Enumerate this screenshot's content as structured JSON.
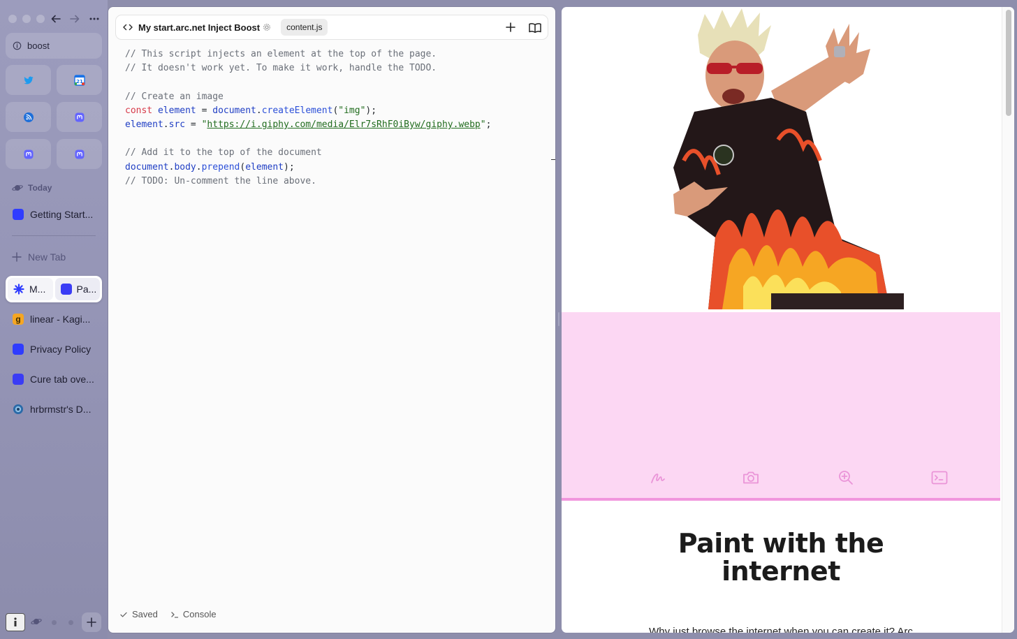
{
  "window": {
    "controls": [
      "close",
      "minimize",
      "zoom"
    ]
  },
  "sidebar": {
    "address": "boost",
    "favorites": [
      {
        "name": "twitter",
        "icon": "twitter-bird-icon",
        "color": "#1d9bf0"
      },
      {
        "name": "calendar",
        "icon": "google-calendar-icon",
        "color": "#1a73e8",
        "badge": "21"
      },
      {
        "name": "feed",
        "icon": "feed-icon",
        "color": "#1e6fd9"
      },
      {
        "name": "mastodon-1",
        "icon": "mastodon-icon",
        "color": "#6364ff"
      },
      {
        "name": "mastodon-2",
        "icon": "mastodon-icon",
        "color": "#6364ff"
      },
      {
        "name": "mastodon-3",
        "icon": "mastodon-icon",
        "color": "#6364ff"
      }
    ],
    "section_label": "Today",
    "today_tabs": [
      {
        "label": "Getting Start...",
        "icon_color": "#2f3cff"
      }
    ],
    "new_tab_label": "New Tab",
    "split_tab": {
      "left_label": "M...",
      "right_label": "Pa..."
    },
    "tabs": [
      {
        "label": "linear - Kagi...",
        "icon": "kagi-icon",
        "icon_color": "#f5a623"
      },
      {
        "label": "Privacy Policy",
        "icon": "tab-square-icon",
        "icon_color": "#2f3cff"
      },
      {
        "label": "Cure tab ove...",
        "icon": "tab-square-icon",
        "icon_color": "#3a3cf5"
      },
      {
        "label": "hrbrmstr's D...",
        "icon": "globe-icon",
        "icon_color": "#2a6aa8"
      }
    ]
  },
  "editor": {
    "title": "My start.arc.net Inject Boost",
    "file_tab": "content.js",
    "footer": {
      "saved": "Saved",
      "console": "Console"
    },
    "code": [
      [
        {
          "t": "// This script injects an element at the top of the page.",
          "c": "com"
        }
      ],
      [
        {
          "t": "// It doesn't work yet. To make it work, handle the TODO.",
          "c": "com"
        }
      ],
      [],
      [
        {
          "t": "// Create an image",
          "c": "com"
        }
      ],
      [
        {
          "t": "const",
          "c": "kw"
        },
        {
          "t": " ",
          "c": ""
        },
        {
          "t": "element",
          "c": "var"
        },
        {
          "t": " = ",
          "c": ""
        },
        {
          "t": "document",
          "c": "var"
        },
        {
          "t": ".",
          "c": ""
        },
        {
          "t": "createElement",
          "c": "fn"
        },
        {
          "t": "(",
          "c": ""
        },
        {
          "t": "\"img\"",
          "c": "str"
        },
        {
          "t": ");",
          "c": ""
        }
      ],
      [
        {
          "t": "element",
          "c": "var"
        },
        {
          "t": ".",
          "c": ""
        },
        {
          "t": "src",
          "c": "var"
        },
        {
          "t": " = ",
          "c": ""
        },
        {
          "t": "\"",
          "c": "str"
        },
        {
          "t": "https://i.giphy.com/media/Elr7sRhF0iByw/giphy.webp",
          "c": "url"
        },
        {
          "t": "\"",
          "c": "str"
        },
        {
          "t": ";",
          "c": ""
        }
      ],
      [],
      [
        {
          "t": "// Add it to the top of the document",
          "c": "com"
        }
      ],
      [
        {
          "t": "document",
          "c": "var"
        },
        {
          "t": ".",
          "c": ""
        },
        {
          "t": "body",
          "c": "var"
        },
        {
          "t": ".",
          "c": ""
        },
        {
          "t": "prepend",
          "c": "fn"
        },
        {
          "t": "(",
          "c": ""
        },
        {
          "t": "element",
          "c": "var"
        },
        {
          "t": ");",
          "c": ""
        }
      ],
      [
        {
          "t": "// TODO: Un-comment the line above.",
          "c": "com"
        }
      ]
    ]
  },
  "webview": {
    "headline": "Paint with the internet",
    "body_text": "Why just browse the internet when you can create it? Arc",
    "tools": [
      "pen-icon",
      "camera-icon",
      "zoom-in-icon",
      "terminal-icon"
    ],
    "colors": {
      "pink": "#fcd7f3",
      "pink_border": "#f196dd",
      "icon": "#ea94d8"
    }
  }
}
